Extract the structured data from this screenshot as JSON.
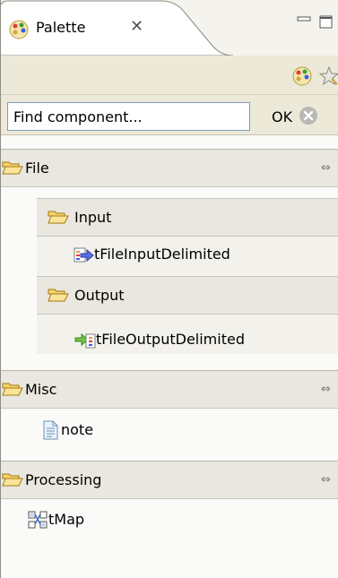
{
  "view": {
    "tab_title": "Palette",
    "tab_close_glyph": "✕",
    "tab_icon": "palette-icon",
    "window_buttons": [
      "minimize-icon",
      "maximize-icon"
    ]
  },
  "toolbar": {
    "icons": [
      "palette-settings-icon",
      "favorites-star-icon"
    ]
  },
  "search": {
    "value": "Find component...",
    "placeholder": "Find component...",
    "ok_label": "OK",
    "clear_icon": "clear-icon"
  },
  "drawers": [
    {
      "label": "File",
      "pin_glyph": "⇔",
      "children": [
        {
          "label": "Input",
          "entries": [
            {
              "label": "tFileInputDelimited",
              "icon": "file-input-icon"
            }
          ]
        },
        {
          "label": "Output",
          "entries": [
            {
              "label": "tFileOutputDelimited",
              "icon": "file-output-icon"
            }
          ]
        }
      ]
    },
    {
      "label": "Misc",
      "pin_glyph": "⇔",
      "entries": [
        {
          "label": "note",
          "icon": "note-icon"
        }
      ]
    },
    {
      "label": "Processing",
      "pin_glyph": "⇔",
      "entries": [
        {
          "label": "tMap",
          "icon": "tmap-icon"
        }
      ]
    }
  ],
  "colors": {
    "folder_fill": "#f7d36b",
    "folder_stroke": "#a37a12",
    "drawer_bg": "#e9e7df",
    "toolbar_bg": "#ece9d8"
  }
}
